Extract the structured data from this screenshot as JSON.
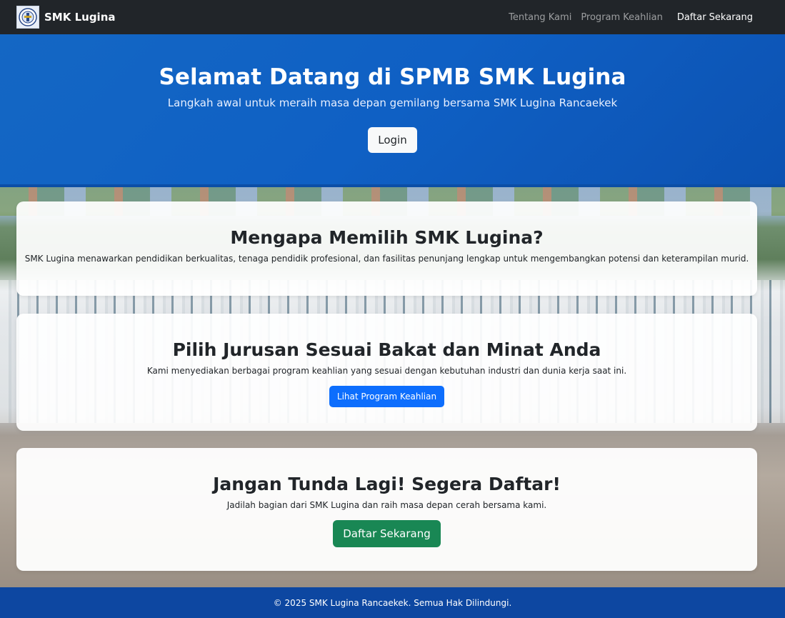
{
  "navbar": {
    "brand": "SMK Lugina",
    "links": [
      "Tentang Kami",
      "Program Keahlian"
    ],
    "cta": "Daftar Sekarang"
  },
  "hero": {
    "title": "Selamat Datang di SPMB SMK Lugina",
    "subtitle": "Langkah awal untuk meraih masa depan gemilang bersama SMK Lugina Rancaekek",
    "login_label": "Login"
  },
  "sections": {
    "why": {
      "title": "Mengapa Memilih SMK Lugina?",
      "text": "SMK Lugina menawarkan pendidikan berkualitas, tenaga pendidik profesional, dan fasilitas penunjang lengkap untuk mengembangkan potensi dan keterampilan murid."
    },
    "programs": {
      "title": "Pilih Jurusan Sesuai Bakat dan Minat Anda",
      "text": "Kami menyediakan berbagai program keahlian yang sesuai dengan kebutuhan industri dan dunia kerja saat ini.",
      "button": "Lihat Program Keahlian"
    },
    "register": {
      "title": "Jangan Tunda Lagi! Segera Daftar!",
      "text": "Jadilah bagian dari SMK Lugina dan raih masa depan cerah bersama kami.",
      "button": "Daftar Sekarang"
    }
  },
  "footer": {
    "text": "© 2025 SMK Lugina Rancaekek. Semua Hak Dilindungi."
  },
  "colors": {
    "navbar_bg": "#212529",
    "hero_bg": "#1467c4",
    "primary": "#0d6efd",
    "success": "#198754",
    "footer_bg": "#0d47a1"
  },
  "icons": {
    "logo": "school-emblem-icon"
  }
}
